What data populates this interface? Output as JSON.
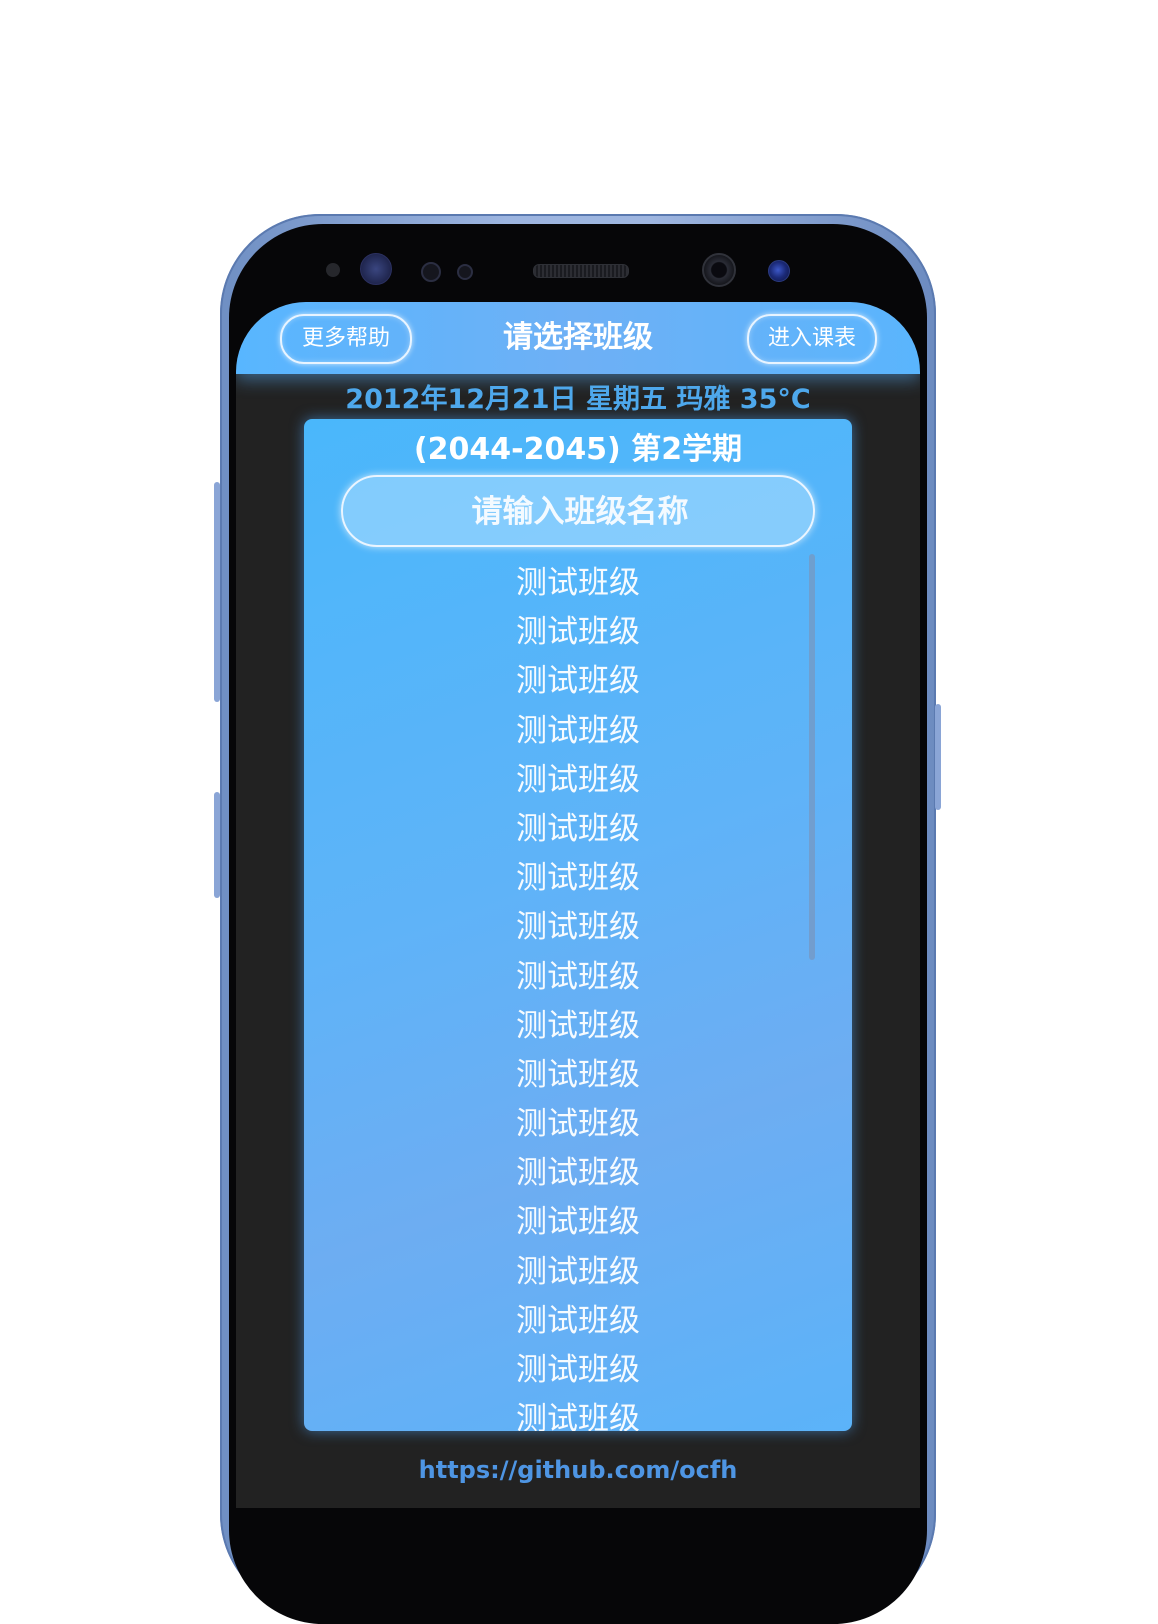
{
  "header": {
    "help_button": "更多帮助",
    "title": "请选择班级",
    "enter_button": "进入课表"
  },
  "info_line": "2012年12月21日 星期五 玛雅 35°C",
  "term": "(2044-2045) 第2学期",
  "search": {
    "placeholder": "请输入班级名称",
    "value": ""
  },
  "class_list": [
    "测试班级",
    "测试班级",
    "测试班级",
    "测试班级",
    "测试班级",
    "测试班级",
    "测试班级",
    "测试班级",
    "测试班级",
    "测试班级",
    "测试班级",
    "测试班级",
    "测试班级",
    "测试班级",
    "测试班级",
    "测试班级",
    "测试班级",
    "测试班级"
  ],
  "footer_link": "https://github.com/ocfh",
  "colors": {
    "accent": "#58b6ff",
    "screen_background": "#222222",
    "date_text": "#4ea8ec",
    "link_text": "#4e95e3",
    "phone_frame": "#8aa5d6"
  }
}
